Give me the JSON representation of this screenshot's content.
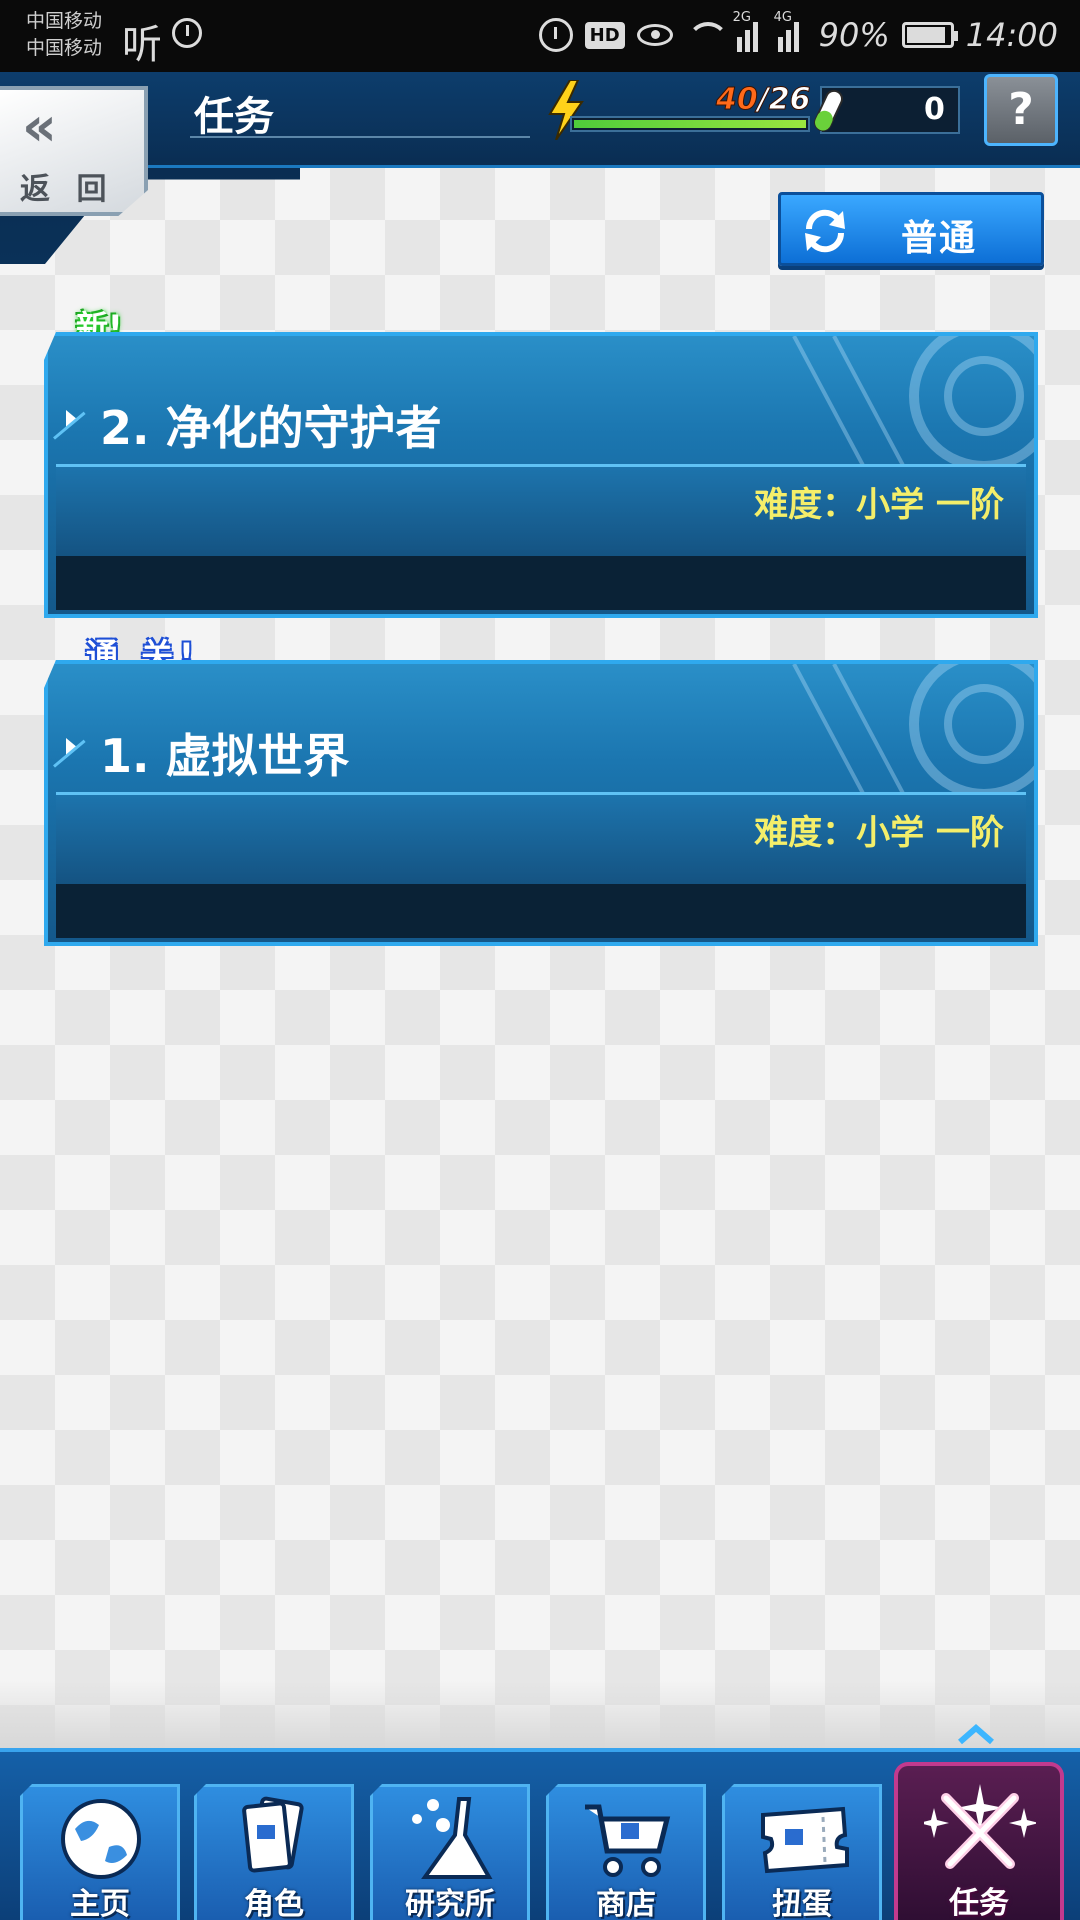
{
  "status_bar": {
    "carrier_1": "中国移动",
    "carrier_2": "中国移动",
    "listen_app": "听",
    "signal_2g": "2G",
    "signal_4g": "4G",
    "hd_badge": "HD",
    "battery_percent": "90%",
    "time": "14:00",
    "icons": [
      "timer-icon",
      "alarm-icon",
      "hd-icon",
      "eye-icon",
      "wifi-icon",
      "signal-icon",
      "battery-icon"
    ]
  },
  "header": {
    "back_label": "返 回",
    "back_chevron": "«",
    "title": "任务",
    "energy_current": "40",
    "energy_max": "/26",
    "energy_fill_fraction": 1.0,
    "gem_count": "0",
    "help_label": "?"
  },
  "mode_button": {
    "label": "普通",
    "icon": "refresh-icon"
  },
  "missions": [
    {
      "badge": "新!",
      "title": "2. 净化的守护者",
      "difficulty": "难度：小学 一阶"
    },
    {
      "badge": "通 关!",
      "title": "1. 虚拟世界",
      "difficulty": "难度：小学 一阶"
    }
  ],
  "nav": {
    "items": [
      {
        "label": "主页",
        "icon": "globe-icon"
      },
      {
        "label": "角色",
        "icon": "card-icon"
      },
      {
        "label": "研究所",
        "icon": "lab-flask-icon"
      },
      {
        "label": "商店",
        "icon": "cart-icon"
      },
      {
        "label": "扭蛋",
        "icon": "ticket-icon"
      },
      {
        "label": "任务",
        "icon": "crossed-swords-icon",
        "active": true
      }
    ]
  },
  "colors": {
    "header_bg": "#0d3d6c",
    "card_blue": "#1b76b0",
    "difficulty_yellow": "#f4ee6a",
    "energy_orange": "#ff6a1a",
    "active_nav_bg": "#5a1e52",
    "active_nav_border": "#c23a8e"
  }
}
